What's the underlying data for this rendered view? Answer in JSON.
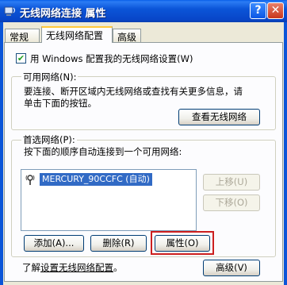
{
  "window": {
    "title": "无线网络连接 属性",
    "help_button": "?",
    "close_button": "✕"
  },
  "tabs": [
    {
      "label": "常规"
    },
    {
      "label": "无线网络配置"
    },
    {
      "label": "高级"
    }
  ],
  "use_windows_checkbox": {
    "label": "用 Windows 配置我的无线网络设置(W)",
    "checked": true
  },
  "available_networks": {
    "legend": "可用网络(N):",
    "description_line1": "要连接、断开区域内无线网络或查找有关更多信息，请",
    "description_line2": "单击下面的按钮。",
    "view_button": "查看无线网络"
  },
  "preferred_networks": {
    "legend": "首选网络(P):",
    "description": "按下面的顺序自动连接到一个可用网络:",
    "items": [
      {
        "label": "MERCURY_90CCFC (自动)",
        "icon": "network-antenna-icon"
      }
    ],
    "move_up_button": "上移(U)",
    "move_down_button": "下移(O)",
    "add_button": "添加(A)...",
    "remove_button": "删除(R)",
    "properties_button": "属性(O)"
  },
  "footer": {
    "learn_prefix": "了解",
    "learn_link": "设置无线网络配置",
    "learn_suffix": "。",
    "advanced_button": "高级(V)"
  },
  "colors": {
    "highlight": "#316ac5",
    "red_box": "#cc1f1f",
    "titlebar": "#0b55d8"
  }
}
